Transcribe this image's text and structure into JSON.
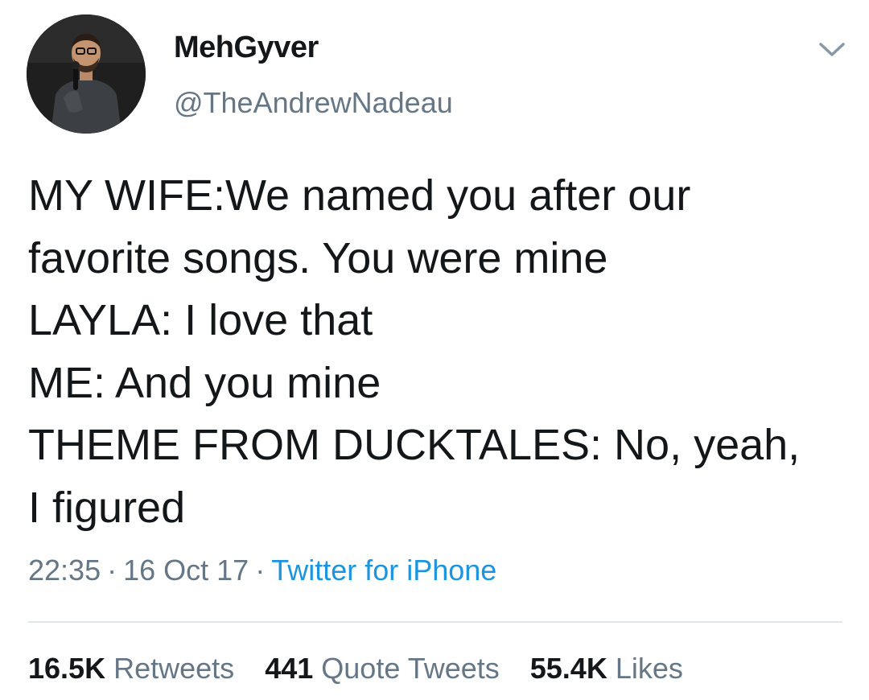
{
  "author": {
    "display_name": "MehGyver",
    "handle": "@TheAndrewNadeau"
  },
  "tweet": {
    "lines": [
      "MY WIFE:We named you after our",
      "favorite songs. You were mine",
      "LAYLA: I love that",
      "ME: And you mine",
      "THEME FROM DUCKTALES: No, yeah,",
      "I figured"
    ],
    "time": "22:35",
    "date": "16 Oct 17",
    "separator": "·",
    "source": "Twitter for iPhone"
  },
  "stats": {
    "retweets_count": "16.5K",
    "retweets_label": "Retweets",
    "quote_count": "441",
    "quote_label": "Quote Tweets",
    "likes_count": "55.4K",
    "likes_label": "Likes"
  },
  "icons": {
    "menu": "chevron-down-icon"
  },
  "colors": {
    "text": "#14171a",
    "secondary": "#657786",
    "link": "#1b95e0",
    "divider": "#e1e8ed"
  }
}
